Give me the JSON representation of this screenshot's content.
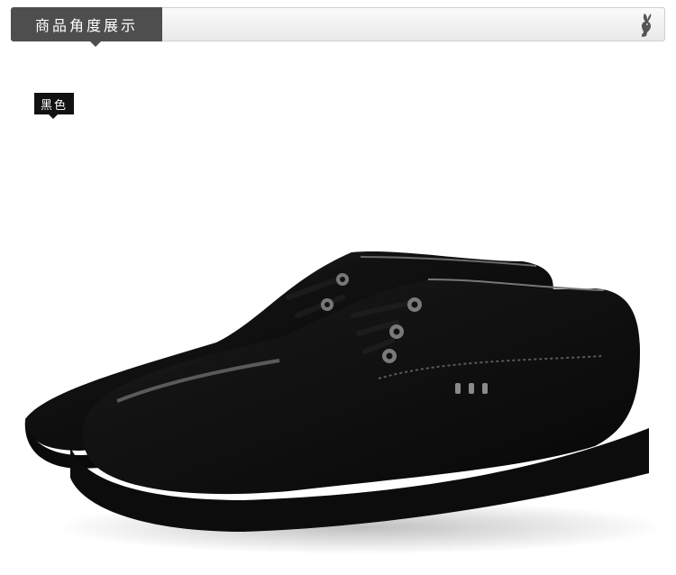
{
  "header": {
    "title": "商品角度展示",
    "logo_icon": "rabbit-logo-icon"
  },
  "color_badge": {
    "label": "黑色"
  },
  "product": {
    "image_icon": "black-leather-shoes-image"
  },
  "colors": {
    "header_tab": "#4e4e4e",
    "badge": "#111111",
    "background": "#ffffff"
  }
}
